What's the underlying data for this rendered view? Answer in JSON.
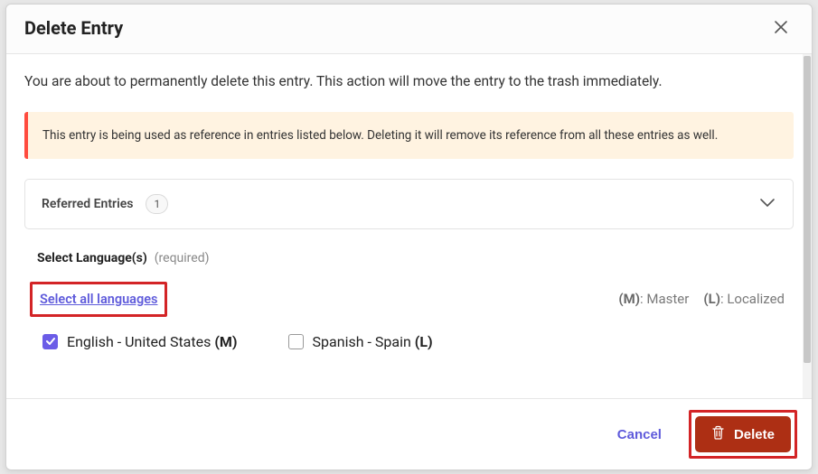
{
  "modal": {
    "title": "Delete Entry",
    "intro": "You are about to permanently delete this entry. This action will move the entry to the trash immediately.",
    "warning": "This entry is being used as reference in entries listed below. Deleting it will remove its reference from all these entries as well.",
    "referred": {
      "label": "Referred Entries",
      "count": "1"
    },
    "languages": {
      "section_label": "Select Language(s)",
      "required": "(required)",
      "select_all": "Select all languages",
      "legend_master_key": "(M)",
      "legend_master_val": ": Master",
      "legend_local_key": "(L)",
      "legend_local_val": ": Localized",
      "items": [
        {
          "label": "English - United States ",
          "suffix": "(M)",
          "checked": true
        },
        {
          "label": "Spanish - Spain ",
          "suffix": "(L)",
          "checked": false
        }
      ]
    },
    "footer": {
      "cancel": "Cancel",
      "delete": "Delete"
    }
  }
}
